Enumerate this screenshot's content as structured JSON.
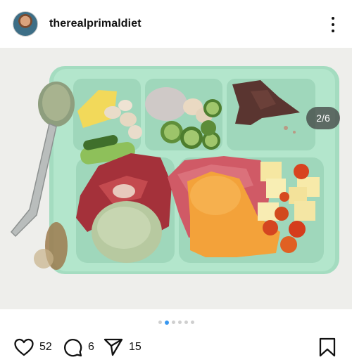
{
  "post": {
    "username": "therealprimaldiet",
    "image_counter": "2/6"
  },
  "carousel": {
    "total": 6,
    "active_index": 1
  },
  "actions": {
    "likes": "52",
    "comments": "6",
    "shares": "15"
  },
  "icons": {
    "like": "heart-icon",
    "comment": "comment-bubble-icon",
    "share": "paper-plane-icon",
    "save": "bookmark-icon",
    "more": "more-vertical-icon"
  },
  "colors": {
    "tray": "#a9dfc3",
    "active_dot": "#3897f0",
    "counter_badge": "#3c3c3c"
  }
}
